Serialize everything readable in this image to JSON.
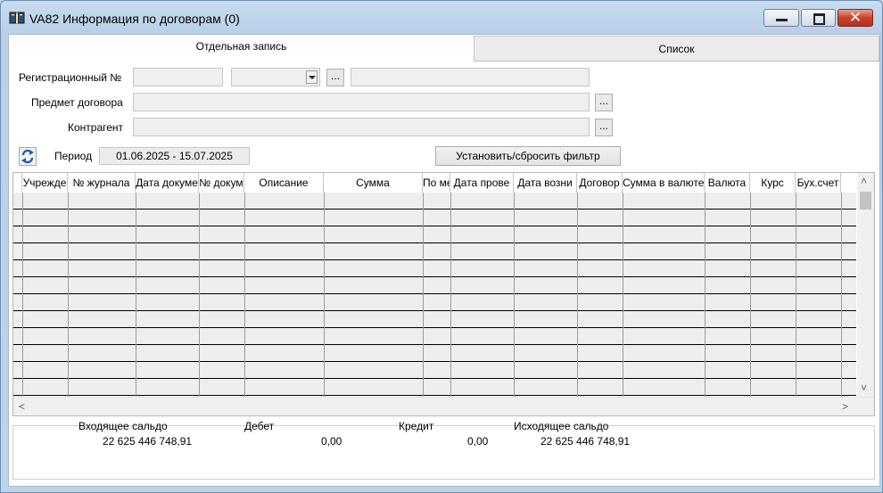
{
  "window": {
    "title": "VA82 Информация по договорам (0)",
    "close_symbol": "✕"
  },
  "tabs": [
    {
      "label": "Отдельная запись",
      "active": true
    },
    {
      "label": "Список",
      "active": false
    }
  ],
  "form": {
    "reg_number_label": "Регистрационный №",
    "subject_label": "Предмет договора",
    "counterparty_label": "Контрагент",
    "browse_label": "...",
    "period_label": "Период",
    "period_value": "01.06.2025  -  15.07.2025",
    "filter_button": "Установить/сбросить фильтр"
  },
  "table": {
    "columns": [
      "Учрежде",
      "№ журнала",
      "Дата докуме",
      "№ докум",
      "Описание",
      "Сумма",
      "По ме",
      "Дата прове",
      "Дата возни",
      "Договор",
      "Сумма в валюте",
      "Валюта",
      "Курс",
      "Бух.счет"
    ],
    "rows_visible": 12,
    "scroll_up": "˄",
    "scroll_down": "˅",
    "scroll_left": "<",
    "scroll_right": ">"
  },
  "totals": {
    "opening_label": "Входящее сальдо",
    "opening_value": "22 625 446 748,91",
    "debit_label": "Дебет",
    "debit_value": "0,00",
    "credit_label": "Кредит",
    "credit_value": "0,00",
    "closing_label": "Исходящее сальдо",
    "closing_value": "22 625 446 748,91"
  },
  "colors": {
    "accent": "#1a5fb4",
    "close_button": "#c8412c"
  }
}
